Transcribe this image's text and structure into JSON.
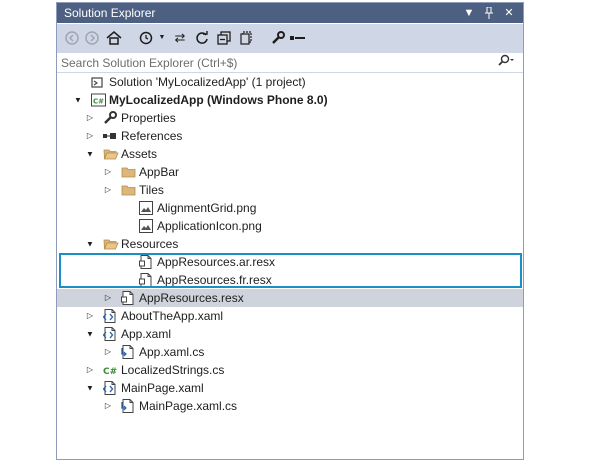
{
  "window": {
    "title": "Solution Explorer"
  },
  "search": {
    "placeholder": "Search Solution Explorer (Ctrl+$)"
  },
  "tree": [
    {
      "label": "Solution 'MyLocalizedApp' (1 project)",
      "icon": "solution-icon",
      "arrow": "",
      "bold": false
    },
    {
      "label": "MyLocalizedApp (Windows Phone 8.0)",
      "icon": "csharp-project-icon",
      "arrow": "▲",
      "bold": true
    },
    {
      "label": "Properties",
      "icon": "wrench-icon",
      "arrow": "▷",
      "bold": false
    },
    {
      "label": "References",
      "icon": "references-icon",
      "arrow": "▷",
      "bold": false
    },
    {
      "label": "Assets",
      "icon": "folder-open-icon",
      "arrow": "▲",
      "bold": false
    },
    {
      "label": "AppBar",
      "icon": "folder-icon",
      "arrow": "▷",
      "bold": false
    },
    {
      "label": "Tiles",
      "icon": "folder-icon",
      "arrow": "▷",
      "bold": false
    },
    {
      "label": "AlignmentGrid.png",
      "icon": "image-icon",
      "arrow": "",
      "bold": false
    },
    {
      "label": "ApplicationIcon.png",
      "icon": "image-icon",
      "arrow": "",
      "bold": false
    },
    {
      "label": "Resources",
      "icon": "folder-open-icon",
      "arrow": "▲",
      "bold": false
    },
    {
      "label": "AppResources.ar.resx",
      "icon": "resx-file-icon",
      "arrow": "",
      "bold": false
    },
    {
      "label": "AppResources.fr.resx",
      "icon": "resx-file-icon",
      "arrow": "",
      "bold": false
    },
    {
      "label": "AppResources.resx",
      "icon": "resx-file-icon",
      "arrow": "▷",
      "bold": false,
      "selected": true
    },
    {
      "label": "AboutTheApp.xaml",
      "icon": "xaml-file-icon",
      "arrow": "▷",
      "bold": false
    },
    {
      "label": "App.xaml",
      "icon": "xaml-file-icon",
      "arrow": "▲",
      "bold": false
    },
    {
      "label": "App.xaml.cs",
      "icon": "cs-file-icon",
      "arrow": "▷",
      "bold": false
    },
    {
      "label": "LocalizedStrings.cs",
      "icon": "csharp-icon",
      "arrow": "▷",
      "bold": false
    },
    {
      "label": "MainPage.xaml",
      "icon": "xaml-file-icon",
      "arrow": "▲",
      "bold": false
    },
    {
      "label": "MainPage.xaml.cs",
      "icon": "cs-file-icon",
      "arrow": "▷",
      "bold": false
    }
  ],
  "colors": {
    "titlebar": "#4d6082",
    "toolbar": "#cfd6e5",
    "selected": "#cfd3db",
    "highlight": "#1a8fc6"
  }
}
